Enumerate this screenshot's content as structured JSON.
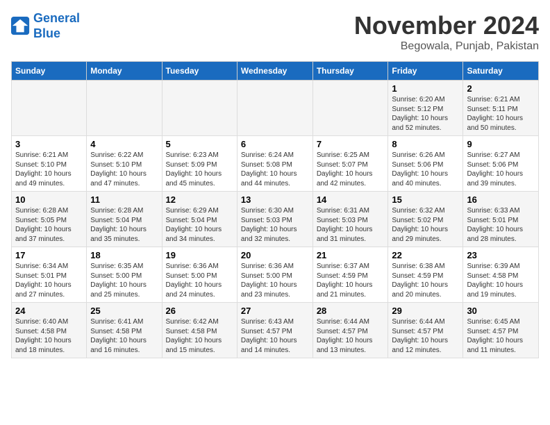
{
  "logo": {
    "line1": "General",
    "line2": "Blue"
  },
  "title": "November 2024",
  "location": "Begowala, Punjab, Pakistan",
  "headers": [
    "Sunday",
    "Monday",
    "Tuesday",
    "Wednesday",
    "Thursday",
    "Friday",
    "Saturday"
  ],
  "weeks": [
    [
      {
        "day": "",
        "sunrise": "",
        "sunset": "",
        "daylight": ""
      },
      {
        "day": "",
        "sunrise": "",
        "sunset": "",
        "daylight": ""
      },
      {
        "day": "",
        "sunrise": "",
        "sunset": "",
        "daylight": ""
      },
      {
        "day": "",
        "sunrise": "",
        "sunset": "",
        "daylight": ""
      },
      {
        "day": "",
        "sunrise": "",
        "sunset": "",
        "daylight": ""
      },
      {
        "day": "1",
        "sunrise": "Sunrise: 6:20 AM",
        "sunset": "Sunset: 5:12 PM",
        "daylight": "Daylight: 10 hours and 52 minutes."
      },
      {
        "day": "2",
        "sunrise": "Sunrise: 6:21 AM",
        "sunset": "Sunset: 5:11 PM",
        "daylight": "Daylight: 10 hours and 50 minutes."
      }
    ],
    [
      {
        "day": "3",
        "sunrise": "Sunrise: 6:21 AM",
        "sunset": "Sunset: 5:10 PM",
        "daylight": "Daylight: 10 hours and 49 minutes."
      },
      {
        "day": "4",
        "sunrise": "Sunrise: 6:22 AM",
        "sunset": "Sunset: 5:10 PM",
        "daylight": "Daylight: 10 hours and 47 minutes."
      },
      {
        "day": "5",
        "sunrise": "Sunrise: 6:23 AM",
        "sunset": "Sunset: 5:09 PM",
        "daylight": "Daylight: 10 hours and 45 minutes."
      },
      {
        "day": "6",
        "sunrise": "Sunrise: 6:24 AM",
        "sunset": "Sunset: 5:08 PM",
        "daylight": "Daylight: 10 hours and 44 minutes."
      },
      {
        "day": "7",
        "sunrise": "Sunrise: 6:25 AM",
        "sunset": "Sunset: 5:07 PM",
        "daylight": "Daylight: 10 hours and 42 minutes."
      },
      {
        "day": "8",
        "sunrise": "Sunrise: 6:26 AM",
        "sunset": "Sunset: 5:06 PM",
        "daylight": "Daylight: 10 hours and 40 minutes."
      },
      {
        "day": "9",
        "sunrise": "Sunrise: 6:27 AM",
        "sunset": "Sunset: 5:06 PM",
        "daylight": "Daylight: 10 hours and 39 minutes."
      }
    ],
    [
      {
        "day": "10",
        "sunrise": "Sunrise: 6:28 AM",
        "sunset": "Sunset: 5:05 PM",
        "daylight": "Daylight: 10 hours and 37 minutes."
      },
      {
        "day": "11",
        "sunrise": "Sunrise: 6:28 AM",
        "sunset": "Sunset: 5:04 PM",
        "daylight": "Daylight: 10 hours and 35 minutes."
      },
      {
        "day": "12",
        "sunrise": "Sunrise: 6:29 AM",
        "sunset": "Sunset: 5:04 PM",
        "daylight": "Daylight: 10 hours and 34 minutes."
      },
      {
        "day": "13",
        "sunrise": "Sunrise: 6:30 AM",
        "sunset": "Sunset: 5:03 PM",
        "daylight": "Daylight: 10 hours and 32 minutes."
      },
      {
        "day": "14",
        "sunrise": "Sunrise: 6:31 AM",
        "sunset": "Sunset: 5:03 PM",
        "daylight": "Daylight: 10 hours and 31 minutes."
      },
      {
        "day": "15",
        "sunrise": "Sunrise: 6:32 AM",
        "sunset": "Sunset: 5:02 PM",
        "daylight": "Daylight: 10 hours and 29 minutes."
      },
      {
        "day": "16",
        "sunrise": "Sunrise: 6:33 AM",
        "sunset": "Sunset: 5:01 PM",
        "daylight": "Daylight: 10 hours and 28 minutes."
      }
    ],
    [
      {
        "day": "17",
        "sunrise": "Sunrise: 6:34 AM",
        "sunset": "Sunset: 5:01 PM",
        "daylight": "Daylight: 10 hours and 27 minutes."
      },
      {
        "day": "18",
        "sunrise": "Sunrise: 6:35 AM",
        "sunset": "Sunset: 5:00 PM",
        "daylight": "Daylight: 10 hours and 25 minutes."
      },
      {
        "day": "19",
        "sunrise": "Sunrise: 6:36 AM",
        "sunset": "Sunset: 5:00 PM",
        "daylight": "Daylight: 10 hours and 24 minutes."
      },
      {
        "day": "20",
        "sunrise": "Sunrise: 6:36 AM",
        "sunset": "Sunset: 5:00 PM",
        "daylight": "Daylight: 10 hours and 23 minutes."
      },
      {
        "day": "21",
        "sunrise": "Sunrise: 6:37 AM",
        "sunset": "Sunset: 4:59 PM",
        "daylight": "Daylight: 10 hours and 21 minutes."
      },
      {
        "day": "22",
        "sunrise": "Sunrise: 6:38 AM",
        "sunset": "Sunset: 4:59 PM",
        "daylight": "Daylight: 10 hours and 20 minutes."
      },
      {
        "day": "23",
        "sunrise": "Sunrise: 6:39 AM",
        "sunset": "Sunset: 4:58 PM",
        "daylight": "Daylight: 10 hours and 19 minutes."
      }
    ],
    [
      {
        "day": "24",
        "sunrise": "Sunrise: 6:40 AM",
        "sunset": "Sunset: 4:58 PM",
        "daylight": "Daylight: 10 hours and 18 minutes."
      },
      {
        "day": "25",
        "sunrise": "Sunrise: 6:41 AM",
        "sunset": "Sunset: 4:58 PM",
        "daylight": "Daylight: 10 hours and 16 minutes."
      },
      {
        "day": "26",
        "sunrise": "Sunrise: 6:42 AM",
        "sunset": "Sunset: 4:58 PM",
        "daylight": "Daylight: 10 hours and 15 minutes."
      },
      {
        "day": "27",
        "sunrise": "Sunrise: 6:43 AM",
        "sunset": "Sunset: 4:57 PM",
        "daylight": "Daylight: 10 hours and 14 minutes."
      },
      {
        "day": "28",
        "sunrise": "Sunrise: 6:44 AM",
        "sunset": "Sunset: 4:57 PM",
        "daylight": "Daylight: 10 hours and 13 minutes."
      },
      {
        "day": "29",
        "sunrise": "Sunrise: 6:44 AM",
        "sunset": "Sunset: 4:57 PM",
        "daylight": "Daylight: 10 hours and 12 minutes."
      },
      {
        "day": "30",
        "sunrise": "Sunrise: 6:45 AM",
        "sunset": "Sunset: 4:57 PM",
        "daylight": "Daylight: 10 hours and 11 minutes."
      }
    ]
  ]
}
